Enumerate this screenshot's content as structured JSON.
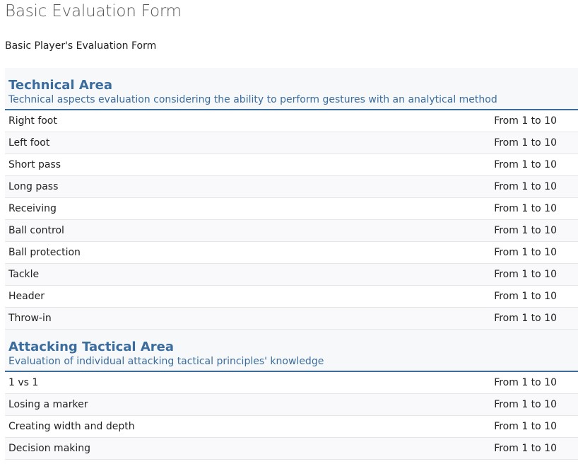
{
  "page": {
    "title": "Basic Evaluation Form",
    "subtitle": "Basic Player's Evaluation Form"
  },
  "sections": [
    {
      "title": "Technical Area",
      "description": "Technical aspects evaluation considering the ability to perform gestures with an analytical method",
      "rows": [
        {
          "criterion": "Right foot",
          "scale": "From 1 to 10"
        },
        {
          "criterion": "Left foot",
          "scale": "From 1 to 10"
        },
        {
          "criterion": "Short pass",
          "scale": "From 1 to 10"
        },
        {
          "criterion": "Long pass",
          "scale": "From 1 to 10"
        },
        {
          "criterion": "Receiving",
          "scale": "From 1 to 10"
        },
        {
          "criterion": "Ball control",
          "scale": "From 1 to 10"
        },
        {
          "criterion": "Ball protection",
          "scale": "From 1 to 10"
        },
        {
          "criterion": "Tackle",
          "scale": "From 1 to 10"
        },
        {
          "criterion": "Header",
          "scale": "From 1 to 10"
        },
        {
          "criterion": "Throw-in",
          "scale": "From 1 to 10"
        }
      ]
    },
    {
      "title": "Attacking Tactical Area",
      "description": "Evaluation of individual attacking tactical principles' knowledge",
      "rows": [
        {
          "criterion": "1 vs 1",
          "scale": "From 1 to 10"
        },
        {
          "criterion": "Losing a marker",
          "scale": "From 1 to 10"
        },
        {
          "criterion": "Creating width and depth",
          "scale": "From 1 to 10"
        },
        {
          "criterion": "Decision making",
          "scale": "From 1 to 10"
        }
      ]
    }
  ],
  "colors": {
    "accent": "#3a6c9e",
    "title_text": "#555555",
    "body_text": "#222222",
    "row_border": "#e6e6e6"
  }
}
